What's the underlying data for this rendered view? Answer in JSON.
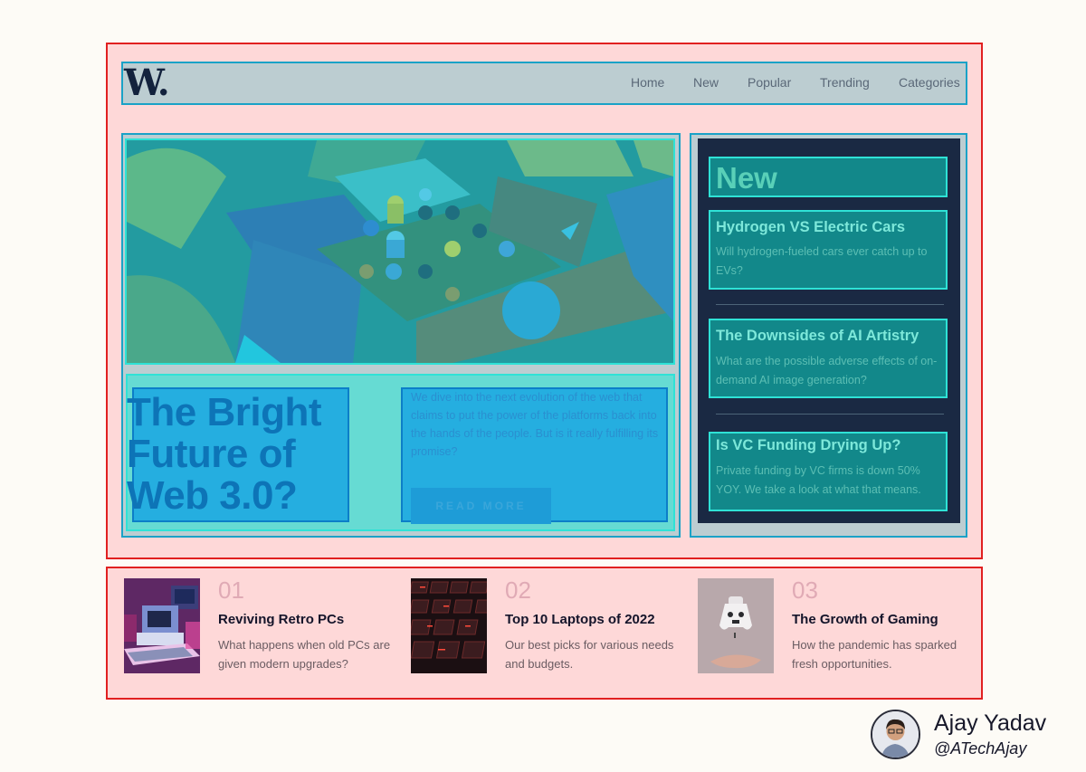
{
  "header": {
    "logo": "W.",
    "nav": [
      "Home",
      "New",
      "Popular",
      "Trending",
      "Categories"
    ]
  },
  "hero": {
    "title": "The Bright Future of Web 3.0?",
    "description": "We dive into the next evolution of the web that claims to put the power of the platforms back into the hands of the people. But is it really fulfilling its promise?",
    "cta": "READ MORE"
  },
  "sidebar": {
    "title": "New",
    "items": [
      {
        "title": "Hydrogen VS Electric Cars",
        "text": "Will hydrogen-fueled cars ever catch up to EVs?"
      },
      {
        "title": "The Downsides of AI Artistry",
        "text": "What are the possible adverse effects of on-demand AI image generation?"
      },
      {
        "title": "Is VC Funding Drying Up?",
        "text": "Private funding by VC firms is down 50% YOY. We take a look at what that means."
      }
    ]
  },
  "cards": [
    {
      "num": "01",
      "title": "Reviving Retro PCs",
      "text": "What happens when old PCs are given modern upgrades?"
    },
    {
      "num": "02",
      "title": "Top 10 Laptops of 2022",
      "text": "Our best picks for various needs and budgets."
    },
    {
      "num": "03",
      "title": "The Growth of Gaming",
      "text": "How the pandemic has sparked fresh opportunities."
    }
  ],
  "author": {
    "name": "Ajay Yadav",
    "handle": "@ATechAjay"
  },
  "colors": {
    "grid_overlay": "#fed8d8",
    "grid_border": "#e12020",
    "sidebar_bg": "#1a2943",
    "accent": "#2fe2d6"
  }
}
